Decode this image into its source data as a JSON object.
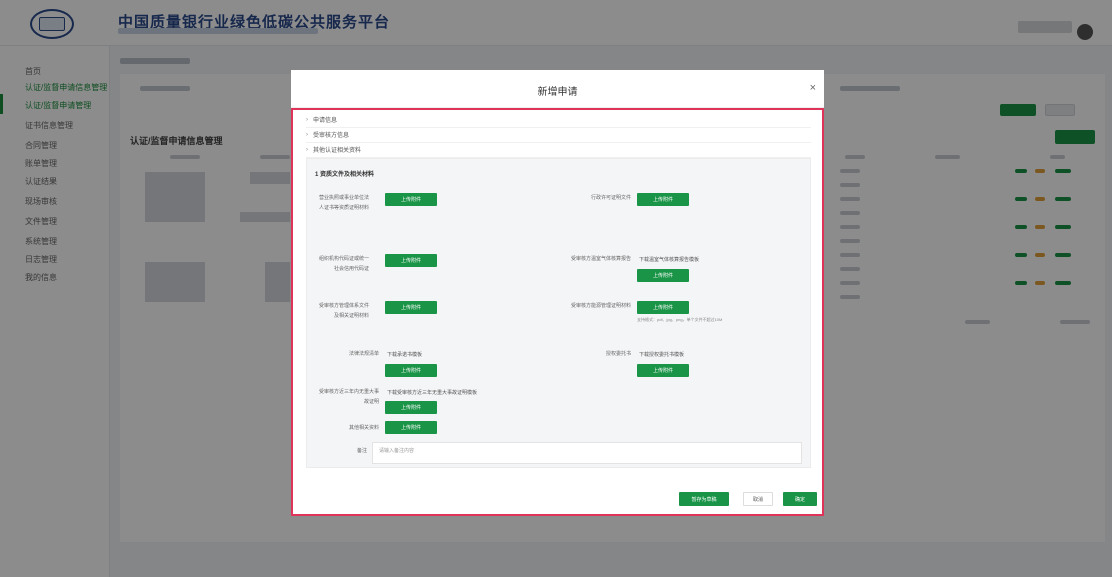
{
  "header": {
    "title": "中国质量银行业绿色低碳公共服务平台"
  },
  "sidebar": {
    "items": [
      {
        "label": "首页"
      },
      {
        "label": "认证/监督申请信息管理"
      },
      {
        "label": "认证/监督申请管理"
      },
      {
        "label": "证书信息管理"
      },
      {
        "label": "合同管理"
      },
      {
        "label": "账单管理"
      },
      {
        "label": "认证结果"
      },
      {
        "label": "现场审核"
      },
      {
        "label": "文件管理"
      },
      {
        "label": "系统管理"
      },
      {
        "label": "日志管理"
      },
      {
        "label": "我的信息"
      }
    ]
  },
  "list": {
    "title": "认证/监督申请信息管理"
  },
  "modal": {
    "title": "新增申请",
    "close": "×",
    "accordion": [
      "申请信息",
      "受审核方信息",
      "其他认证相关资料"
    ],
    "section_title": "1 资质文件及相关材料",
    "upload_label": "上传附件",
    "fields_left": [
      {
        "label": "营业执照或事业单位法人证书等资质证明材料"
      },
      {
        "label": "组织机构代码证或统一社会信用代码证"
      },
      {
        "label": "受审核方管理体系文件及相关证明材料"
      },
      {
        "label": "法律法规清单"
      },
      {
        "label": "受审核方近三年内无重大事故证明"
      },
      {
        "label": "其他相关资料"
      }
    ],
    "fields_right": [
      {
        "label": "行政许可证明文件",
        "template": ""
      },
      {
        "label": "受审核方温室气体核算报告",
        "template": "下载温室气体核算报告模板"
      },
      {
        "label": "受审核方能源管理证明材料",
        "template": "",
        "hint": "支持格式：pdf、jpg、png，单个文件不超过10M"
      },
      {
        "label": "授权委托书",
        "template": "下载授权委托书模板"
      }
    ],
    "left_templates": [
      "下载承诺书模板",
      "下载受审核方近三年无重大事故证明模板"
    ],
    "remark_label": "备注",
    "remark_placeholder": "请输入备注内容",
    "footer": {
      "save_draft": "暂存为草稿",
      "cancel": "取消",
      "confirm": "确定"
    }
  }
}
